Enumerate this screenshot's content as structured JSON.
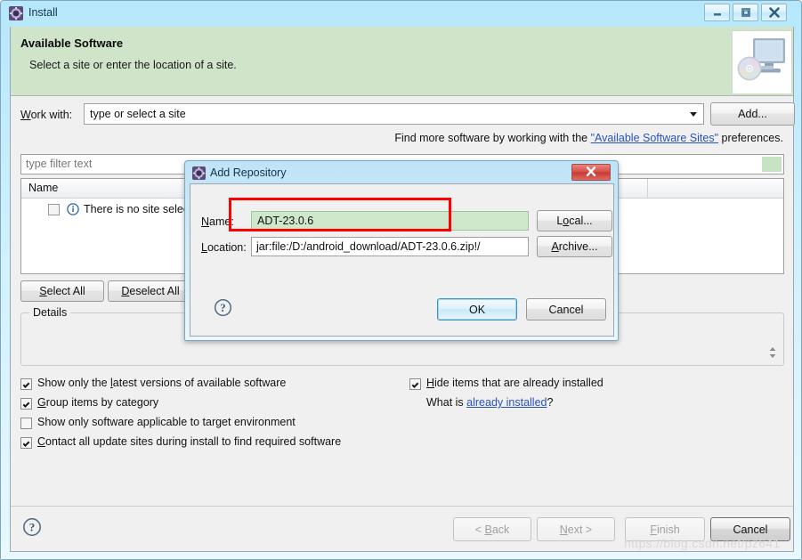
{
  "window": {
    "title": "Install",
    "icon": "eclipse-gear-icon",
    "controls": {
      "minimize": "minimize-icon",
      "maximize": "maximize-icon",
      "close": "close-icon"
    }
  },
  "header": {
    "title": "Available Software",
    "subtitle": "Select a site or enter the location of a site.",
    "art_icon": "computer-with-cd-icon"
  },
  "work_with": {
    "label": "Work with:",
    "label_mnemonic": "W",
    "value": "type or select a site",
    "placeholder": "type or select a site",
    "add_button": "Add...",
    "add_mnemonic": "A"
  },
  "find_more": {
    "prefix": "Find more software by working with the ",
    "link": "\"Available Software Sites\"",
    "suffix": " preferences."
  },
  "filter": {
    "placeholder": "type filter text",
    "value": "",
    "accent_color": "#c8e3c3"
  },
  "tree": {
    "columns": [
      "Name"
    ],
    "rows": [
      {
        "checked": false,
        "icon": "info-icon",
        "label": "There is no site selected."
      }
    ]
  },
  "selection_buttons": {
    "select_all": "Select All",
    "select_all_mnemonic": "S",
    "deselect_all": "Deselect All",
    "deselect_all_mnemonic": "D"
  },
  "details": {
    "legend": "Details",
    "content": "",
    "spinner_icon": "spinner-up-down-icon"
  },
  "options": [
    {
      "label": "Show only the latest versions of available software",
      "checked": true,
      "mnemonic": "l"
    },
    {
      "label": "Group items by category",
      "checked": true,
      "mnemonic": "G"
    },
    {
      "label": "Show only software applicable to target environment",
      "checked": false,
      "mnemonic": ""
    },
    {
      "label": "Contact all update sites during install to find required software",
      "checked": true,
      "mnemonic": "C"
    }
  ],
  "options_right": {
    "hide_installed": {
      "label": "Hide items that are already installed",
      "checked": true,
      "mnemonic": "H"
    },
    "what_is_prefix": "What is ",
    "what_is_link": "already installed",
    "what_is_suffix": "?"
  },
  "footer": {
    "help_icon": "help-question-icon",
    "buttons": [
      {
        "label": "< Back",
        "enabled": false,
        "mnemonic": "B"
      },
      {
        "label": "Next >",
        "enabled": false,
        "mnemonic": "N"
      },
      {
        "label": "Finish",
        "enabled": false,
        "mnemonic": "F"
      },
      {
        "label": "Cancel",
        "enabled": true,
        "mnemonic": ""
      }
    ]
  },
  "watermark": "https://blog.csdn.net/pz641",
  "dialog": {
    "title": "Add Repository",
    "icon": "eclipse-gear-icon",
    "close_icon": "close-icon",
    "name": {
      "label": "Name:",
      "mnemonic": "N",
      "value": "ADT-23.0.6",
      "background_color": "#cfe8cb",
      "highlight_color": "#ff0000"
    },
    "location": {
      "label": "Location:",
      "mnemonic": "L",
      "value": "jar:file:/D:/android_download/ADT-23.0.6.zip!/"
    },
    "local_button": "Local...",
    "local_mnemonic": "o",
    "archive_button": "Archive...",
    "archive_mnemonic": "A",
    "help_icon": "help-question-icon",
    "ok_button": "OK",
    "cancel_button": "Cancel",
    "default_button": "OK"
  }
}
